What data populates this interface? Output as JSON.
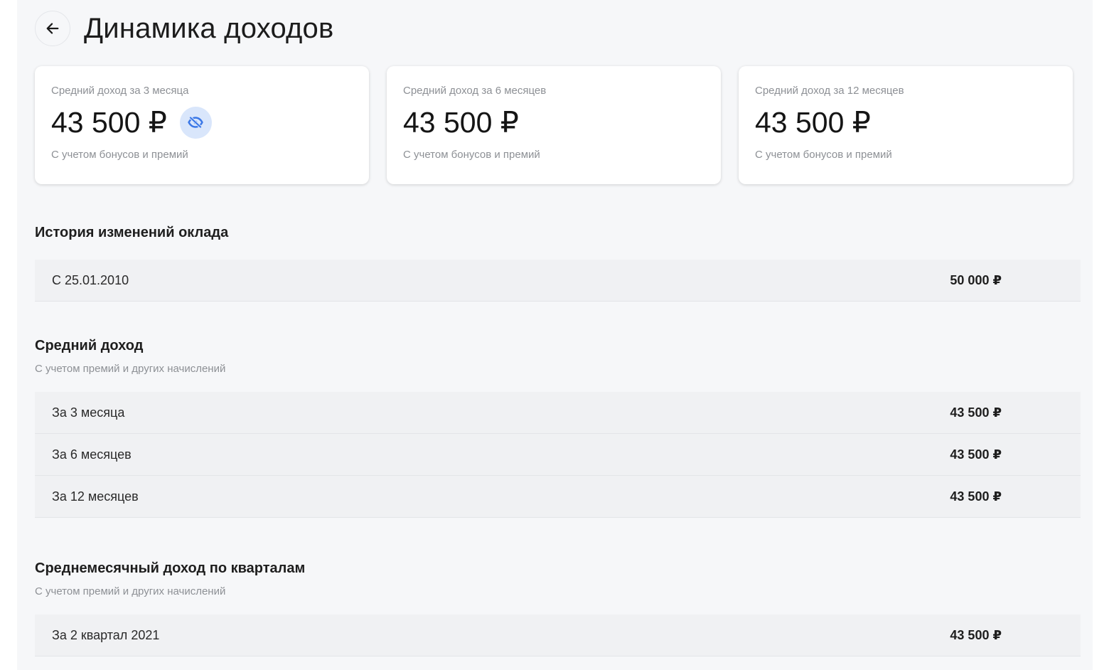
{
  "header": {
    "title": "Динамика доходов",
    "back_icon": "arrow-left-icon"
  },
  "cards": [
    {
      "label": "Средний доход за 3 месяца",
      "amount": "43 500 ₽",
      "note": "С учетом бонусов и премий",
      "eye_icon": "eye-off-icon"
    },
    {
      "label": "Средний доход за 6 месяцев",
      "amount": "43 500 ₽",
      "note": "С учетом бонусов и премий"
    },
    {
      "label": "Средний доход за 12 месяцев",
      "amount": "43 500 ₽",
      "note": "С учетом бонусов и премий"
    }
  ],
  "salary_history": {
    "title": "История изменений оклада",
    "rows": [
      {
        "label": "С 25.01.2010",
        "value": "50 000 ₽"
      }
    ]
  },
  "average_income": {
    "title": "Средний доход",
    "subtitle": "С учетом премий и других начислений",
    "rows": [
      {
        "label": "За 3 месяца",
        "value": "43 500 ₽"
      },
      {
        "label": "За 6 месяцев",
        "value": "43 500 ₽"
      },
      {
        "label": "За 12 месяцев",
        "value": "43 500 ₽"
      }
    ]
  },
  "quarterly_income": {
    "title": "Среднемесячный доход по кварталам",
    "subtitle": "С учетом премий и других начислений",
    "rows": [
      {
        "label": "За 2 квартал 2021",
        "value": "43 500 ₽"
      }
    ]
  },
  "colors": {
    "panel_bg": "#f6f7f9",
    "card_bg": "#ffffff",
    "row_bg": "#f0f1f3",
    "eye_button_bg": "#d9e6fb",
    "eye_icon": "#3b78e7",
    "muted_text": "#8d9095"
  }
}
